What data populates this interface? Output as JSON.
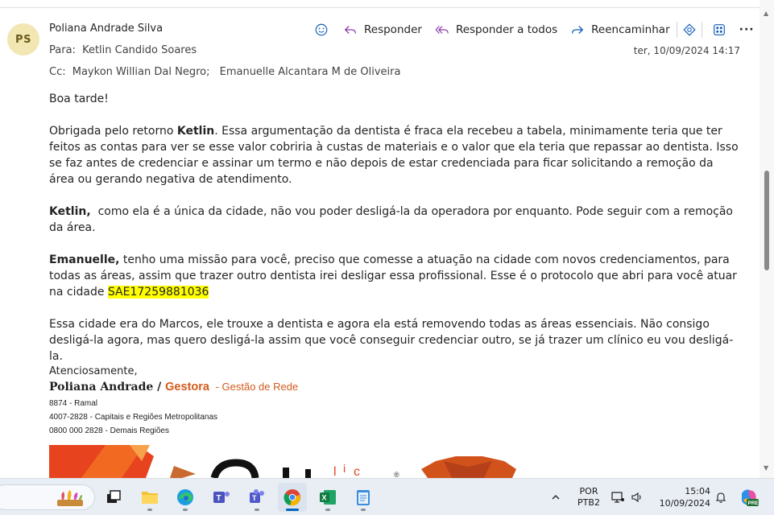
{
  "email": {
    "avatar_initials": "PS",
    "sender": "Poliana Andrade Silva",
    "to_label": "Para:",
    "to": "Ketlin Candido Soares",
    "cc_label": "Cc:",
    "cc": [
      "Maykon Willian Dal Negro;",
      "Emanuelle Alcantara M de Oliveira"
    ],
    "date": "ter, 10/09/2024 14:17"
  },
  "toolbar": {
    "reply": "Responder",
    "reply_all": "Responder a todos",
    "forward": "Reencaminhar",
    "more": "···"
  },
  "body": {
    "greeting": "Boa tarde!",
    "p1_a": "Obrigada pelo retorno ",
    "p1_bold": "Ketlin",
    "p1_b": ". Essa argumentação da dentista é fraca ela recebeu a tabela, minimamente teria que ter feitos as contas para ver se esse valor cobriria à custas de materiais e o valor que ela teria que repassar ao dentista. Isso se faz antes de credenciar e assinar um termo e não depois de estar credenciada para ficar solicitando a remoção da área ou gerando negativa de atendimento.",
    "p2_bold": "Ketlin,",
    "p2": "  como ela é a única da cidade, não vou poder desligá-la da operadora por enquanto. Pode seguir com a remoção da área.",
    "p3_bold": "Emanuelle,",
    "p3": " tenho uma missão para você, preciso que comesse a atuação na cidade com novos credenciamentos, para todas as áreas, assim que trazer outro dentista irei desligar essa profissional. Esse é o protocolo que abri para você atuar na cidade ",
    "protocol": "SAE17259881036",
    "p4": "Essa cidade era do Marcos, ele trouxe a dentista e agora ela está removendo todas as áreas essenciais. Não consigo desligá-la agora, mas quero desligá-la assim que você conseguir credenciar outro, se já trazer um clínico eu vou desligá-la."
  },
  "signature": {
    "regards": "Atenciosamente,",
    "name": "Poliana Andrade / ",
    "role": "Gestora",
    "dept": " - Gestão de Rede",
    "lines": [
      "8874 - Ramal",
      "4007-2828 - Capitais e Regiões Metropolitanas",
      "0800 000 2828 - Demais Regiões"
    ]
  },
  "taskbar": {
    "language": [
      "POR",
      "PTB2"
    ],
    "time": "15:04",
    "date": "10/09/2024",
    "copilot_badge": "PRE"
  },
  "colors": {
    "accent": "#0067c0",
    "highlight": "#ffff00",
    "brand_orange": "#d35a1a",
    "avatar_bg": "#f2e6b3"
  }
}
